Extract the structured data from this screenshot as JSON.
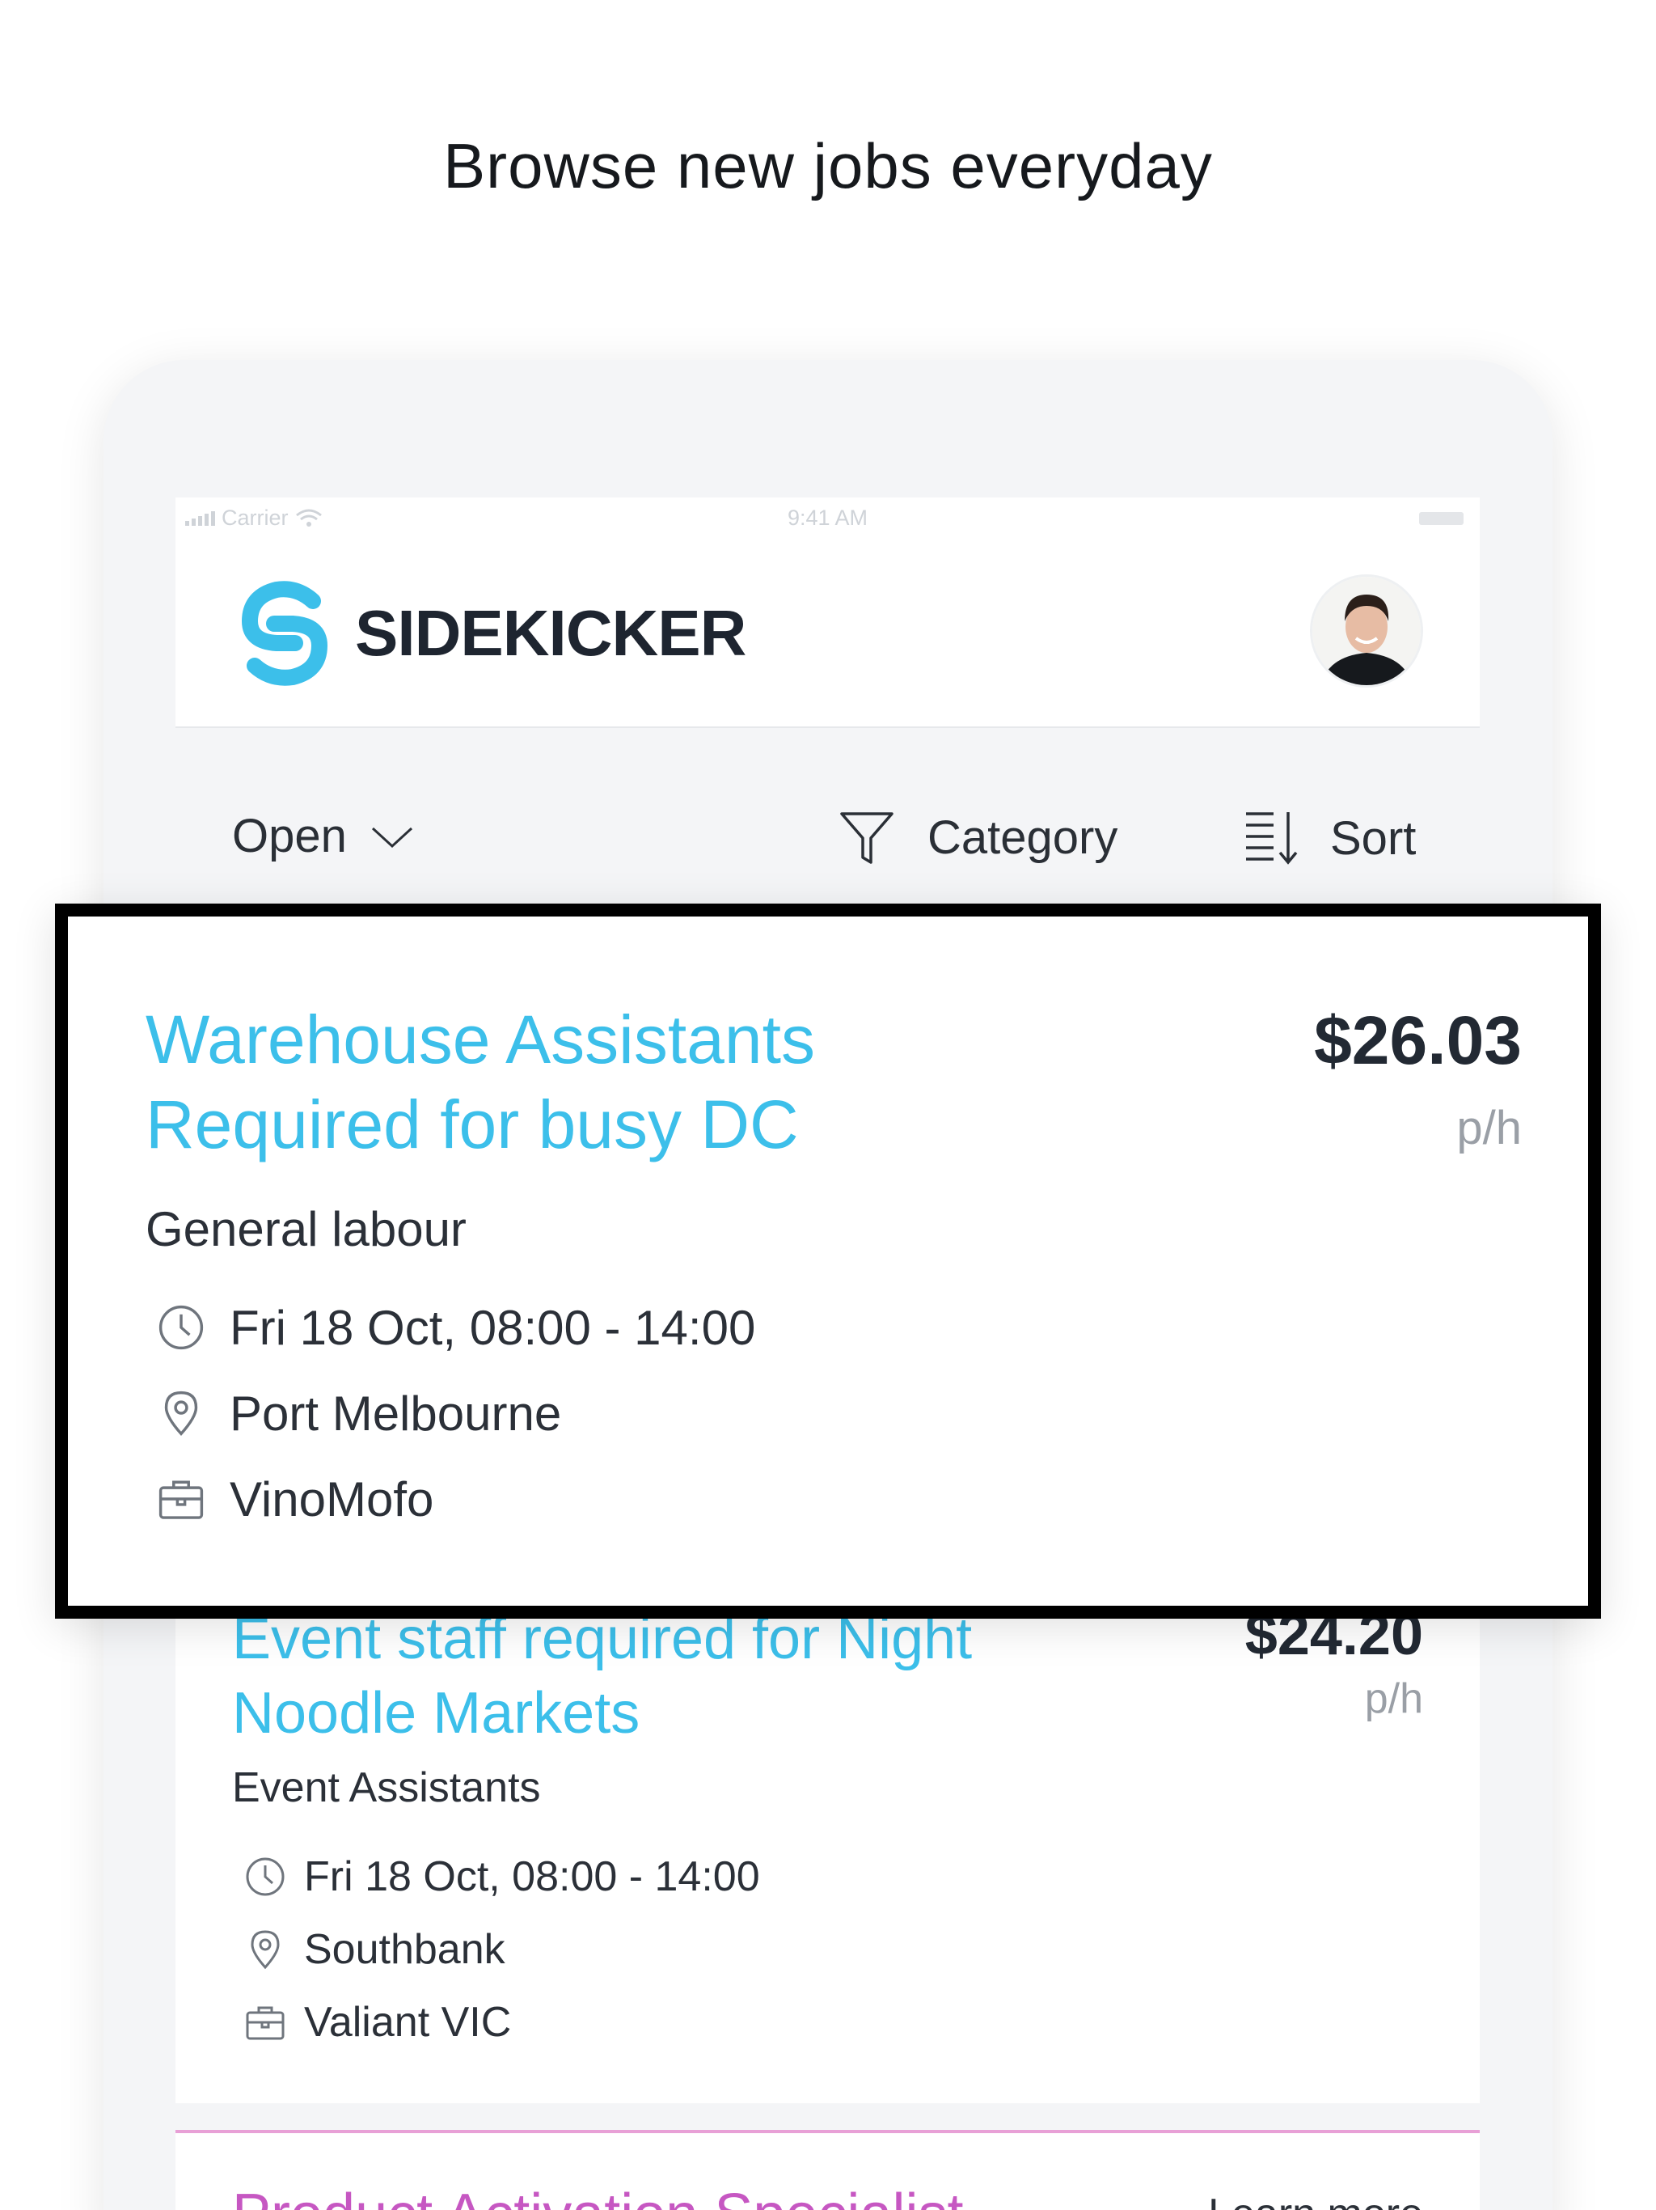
{
  "headline": "Browse new jobs everyday",
  "status_bar": {
    "carrier": "Carrier",
    "time": "9:41 AM"
  },
  "header": {
    "brand": "SIDEKICKER",
    "brand_color": "#3cbfea"
  },
  "filters": {
    "status_label": "Open",
    "category_label": "Category",
    "sort_label": "Sort"
  },
  "jobs": [
    {
      "title": "Warehouse Assistants Required for busy DC",
      "price": "$26.03",
      "unit": "p/h",
      "category": "General labour",
      "datetime": "Fri 18 Oct, 08:00 - 14:00",
      "location": "Port Melbourne",
      "company": "VinoMofo"
    },
    {
      "title": "Event staff required for Night Noodle Markets",
      "price": "$24.20",
      "unit": "p/h",
      "category": "Event Assistants",
      "datetime": "Fri 18 Oct, 08:00 - 14:00",
      "location": "Southbank",
      "company": "Valiant VIC"
    },
    {
      "title": "Product Activation Specialist",
      "link": "Learn more",
      "accent": "#c657c2"
    }
  ]
}
